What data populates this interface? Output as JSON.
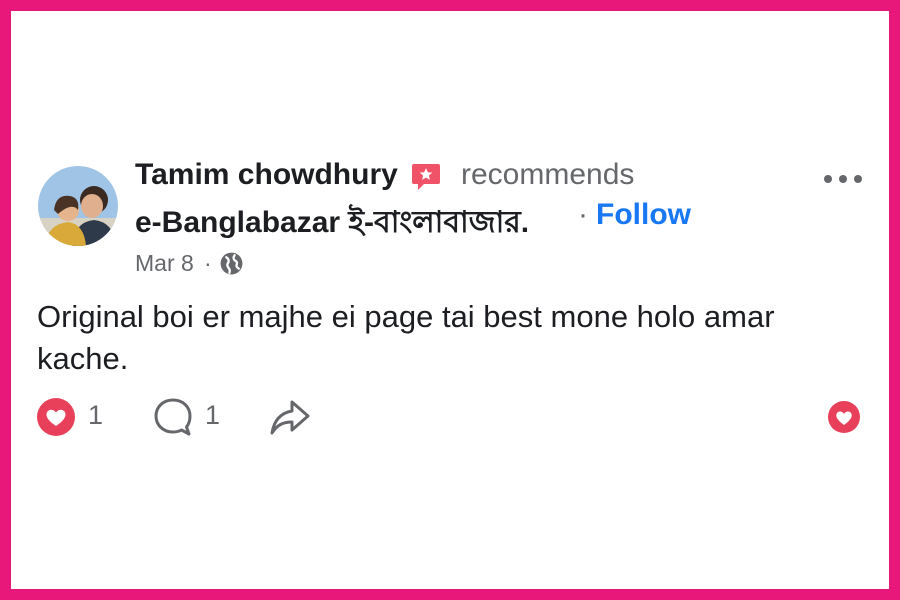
{
  "post": {
    "author_name": "Tamim chowdhury",
    "action": "recommends",
    "page_name": "e-Banglabazar ই-বাংলাবাজার.",
    "separator": "·",
    "follow_label": "Follow",
    "date": "Mar 8",
    "date_separator": "·",
    "text": "Original boi er majhe ei page tai best mone holo amar kache."
  },
  "icons": {
    "badge": "recommend-badge-icon",
    "globe": "globe-icon",
    "more": "more-options-icon",
    "react": "love-reaction-icon",
    "comment": "comment-icon",
    "share": "share-icon"
  },
  "actions": {
    "reaction_count": "1",
    "comment_count": "1"
  },
  "colors": {
    "border": "#e8177a",
    "follow": "#1877f2",
    "reaction": "#e8405a",
    "badge": "#f05268"
  }
}
